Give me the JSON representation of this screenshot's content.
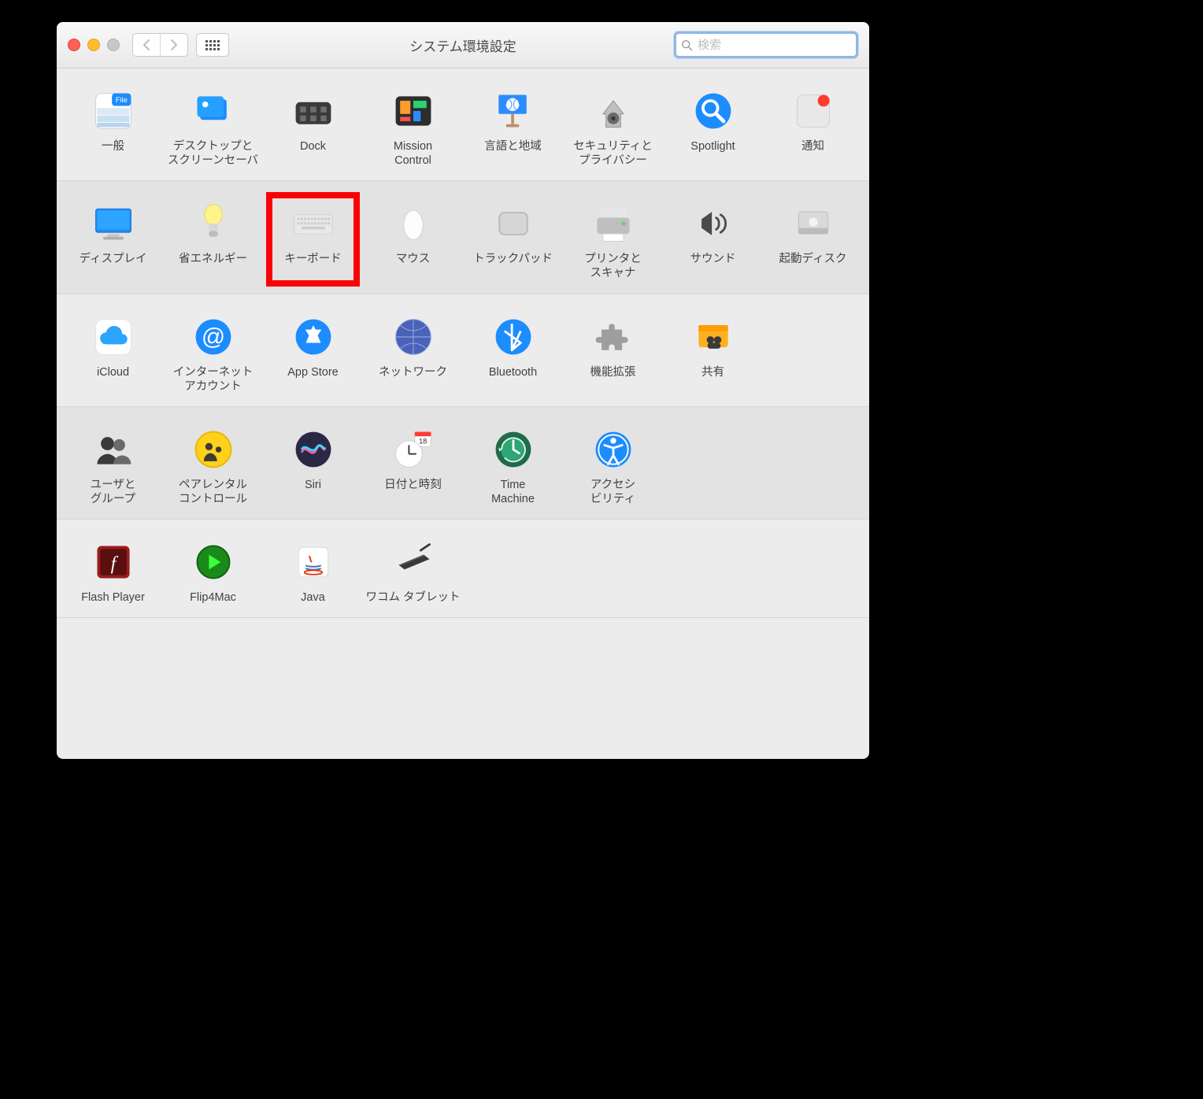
{
  "window": {
    "title": "システム環境設定"
  },
  "search": {
    "placeholder": "検索"
  },
  "highlighted_item": "keyboard",
  "sections": [
    {
      "alt": false,
      "items": [
        {
          "id": "general",
          "label": "一般",
          "icon": "general"
        },
        {
          "id": "desktop",
          "label": "デスクトップと\nスクリーンセーバ",
          "icon": "desktop"
        },
        {
          "id": "dock",
          "label": "Dock",
          "icon": "dock"
        },
        {
          "id": "mission-control",
          "label": "Mission\nControl",
          "icon": "mission"
        },
        {
          "id": "language-region",
          "label": "言語と地域",
          "icon": "language"
        },
        {
          "id": "security",
          "label": "セキュリティと\nプライバシー",
          "icon": "security"
        },
        {
          "id": "spotlight",
          "label": "Spotlight",
          "icon": "spotlight"
        },
        {
          "id": "notifications",
          "label": "通知",
          "icon": "notifications"
        }
      ]
    },
    {
      "alt": true,
      "items": [
        {
          "id": "displays",
          "label": "ディスプレイ",
          "icon": "displays"
        },
        {
          "id": "energy-saver",
          "label": "省エネルギー",
          "icon": "energy"
        },
        {
          "id": "keyboard",
          "label": "キーボード",
          "icon": "keyboard"
        },
        {
          "id": "mouse",
          "label": "マウス",
          "icon": "mouse"
        },
        {
          "id": "trackpad",
          "label": "トラックパッド",
          "icon": "trackpad"
        },
        {
          "id": "printers",
          "label": "プリンタと\nスキャナ",
          "icon": "printers"
        },
        {
          "id": "sound",
          "label": "サウンド",
          "icon": "sound"
        },
        {
          "id": "startup-disk",
          "label": "起動ディスク",
          "icon": "startup"
        }
      ]
    },
    {
      "alt": false,
      "items": [
        {
          "id": "icloud",
          "label": "iCloud",
          "icon": "icloud"
        },
        {
          "id": "internet-accounts",
          "label": "インターネット\nアカウント",
          "icon": "at"
        },
        {
          "id": "app-store",
          "label": "App Store",
          "icon": "appstore"
        },
        {
          "id": "network",
          "label": "ネットワーク",
          "icon": "network"
        },
        {
          "id": "bluetooth",
          "label": "Bluetooth",
          "icon": "bluetooth"
        },
        {
          "id": "extensions",
          "label": "機能拡張",
          "icon": "extensions"
        },
        {
          "id": "sharing",
          "label": "共有",
          "icon": "sharing"
        }
      ]
    },
    {
      "alt": true,
      "items": [
        {
          "id": "users-groups",
          "label": "ユーザと\nグループ",
          "icon": "users"
        },
        {
          "id": "parental-controls",
          "label": "ペアレンタル\nコントロール",
          "icon": "parental"
        },
        {
          "id": "siri",
          "label": "Siri",
          "icon": "siri"
        },
        {
          "id": "date-time",
          "label": "日付と時刻",
          "icon": "datetime"
        },
        {
          "id": "time-machine",
          "label": "Time\nMachine",
          "icon": "timemachine"
        },
        {
          "id": "accessibility",
          "label": "アクセシ\nビリティ",
          "icon": "accessibility"
        }
      ]
    },
    {
      "alt": false,
      "items": [
        {
          "id": "flash-player",
          "label": "Flash Player",
          "icon": "flash"
        },
        {
          "id": "flip4mac",
          "label": "Flip4Mac",
          "icon": "flip4mac"
        },
        {
          "id": "java",
          "label": "Java",
          "icon": "java"
        },
        {
          "id": "wacom-tablet",
          "label": "ワコム タブレット",
          "icon": "wacom"
        }
      ]
    }
  ]
}
